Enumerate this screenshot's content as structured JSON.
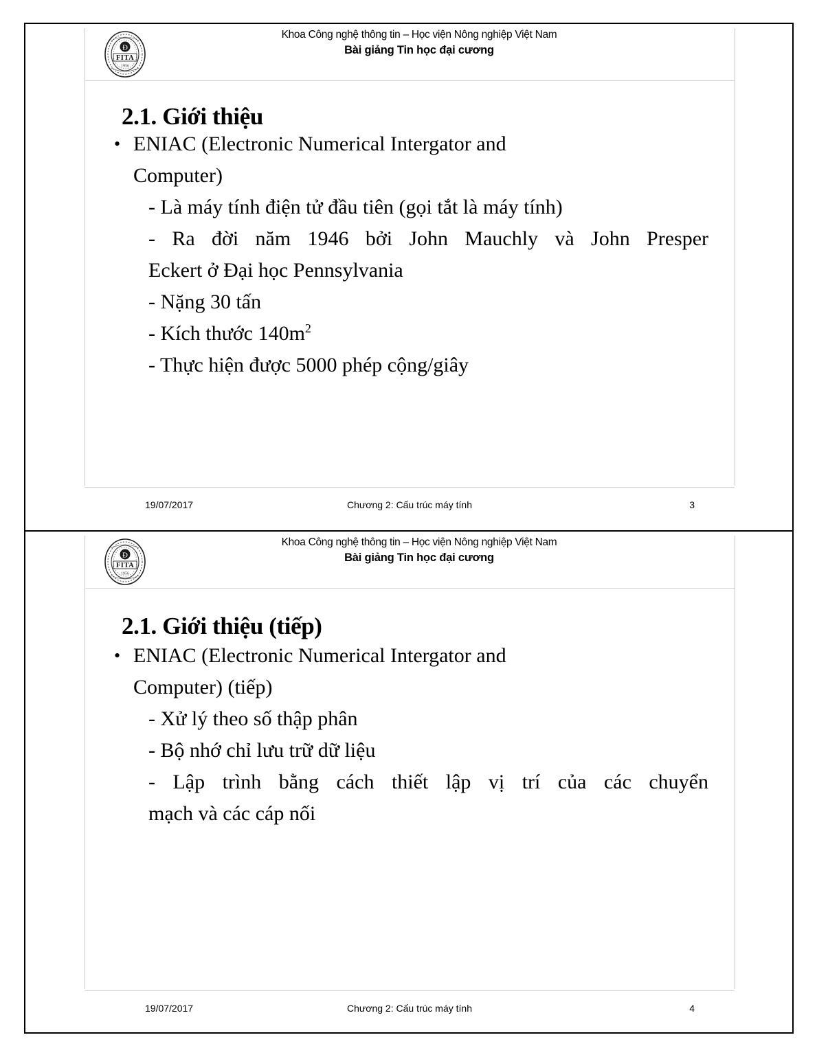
{
  "document": {
    "institution_line": "Khoa Công nghệ thông tin – Học viện Nông nghiệp Việt Nam",
    "course_line": "Bài giảng Tin học đại cương",
    "logo_label": "FITA"
  },
  "slides": [
    {
      "title": "2.1. Giới thiệu",
      "bullet_mark": "•",
      "bullet_line_1": "ENIAC (Electronic Numerical Intergator and",
      "bullet_line_2": "Computer)",
      "sub_items": [
        "- Là máy tính điện tử đầu tiên (gọi tắt là máy tính)",
        "- Ra đời năm 1946 bởi John Mauchly và John Presper",
        "Eckert ở Đại học Pennsylvania",
        "- Nặng 30 tấn",
        "- Kích thước 140m",
        "- Thực hiện được 5000 phép cộng/giây"
      ],
      "superscript": "2",
      "footer": {
        "date": "19/07/2017",
        "center": "Chương 2: Cấu trúc máy tính",
        "page": "3"
      }
    },
    {
      "title": "2.1. Giới thiệu (tiếp)",
      "bullet_mark": "•",
      "bullet_line_1": "ENIAC (Electronic Numerical Intergator and",
      "bullet_line_2": "Computer) (tiếp)",
      "sub_items": [
        "- Xử lý theo số thập phân",
        "- Bộ nhớ chỉ lưu trữ dữ liệu",
        "- Lập trình bằng cách thiết lập vị trí của các chuyển",
        "mạch và các cáp nối"
      ],
      "footer": {
        "date": "19/07/2017",
        "center": "Chương 2: Cấu trúc máy tính",
        "page": "4"
      }
    }
  ]
}
